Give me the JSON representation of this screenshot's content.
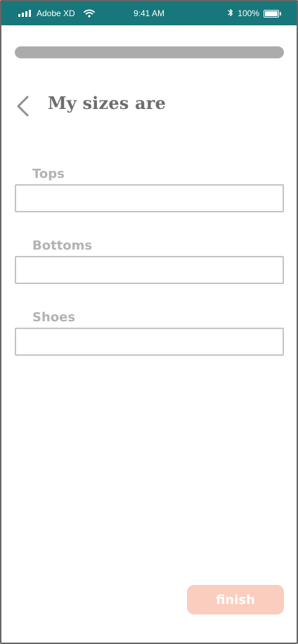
{
  "status_bar": {
    "carrier": "Adobe XD",
    "time": "9:41 AM",
    "battery_percent": "100%",
    "background_color": "#18777a",
    "icons": [
      "signal-icon",
      "wifi-icon",
      "bluetooth-icon",
      "battery-icon"
    ]
  },
  "progress": {
    "value_fraction": 1.0,
    "fill_color": "#ababab"
  },
  "header": {
    "title": "My sizes are",
    "back_icon": "chevron-left-icon"
  },
  "form": {
    "fields": [
      {
        "label": "Tops",
        "value": "",
        "placeholder": ""
      },
      {
        "label": "Bottoms",
        "value": "",
        "placeholder": ""
      },
      {
        "label": "Shoes",
        "value": "",
        "placeholder": ""
      }
    ]
  },
  "actions": {
    "finish_label": "finish",
    "finish_color": "#fbcdbf"
  }
}
